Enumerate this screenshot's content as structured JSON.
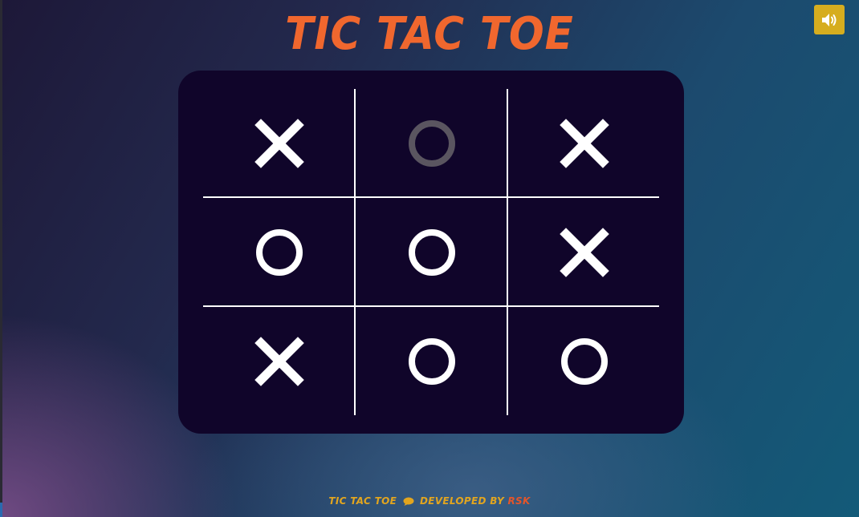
{
  "header": {
    "title": "Tic Tac Toe",
    "sound_icon": "speaker-volume-icon",
    "accent_color": "#f0672e",
    "button_color": "#d6ad1f"
  },
  "board": {
    "background": "#10052a",
    "cells": [
      {
        "mark": "X",
        "faded": false
      },
      {
        "mark": "O",
        "faded": true
      },
      {
        "mark": "X",
        "faded": false
      },
      {
        "mark": "O",
        "faded": false
      },
      {
        "mark": "O",
        "faded": false
      },
      {
        "mark": "X",
        "faded": false
      },
      {
        "mark": "X",
        "faded": false
      },
      {
        "mark": "O",
        "faded": false
      },
      {
        "mark": "O",
        "faded": false
      }
    ]
  },
  "footer": {
    "prefix": "Tic Tac Toe",
    "icon": "chat-bubble-icon",
    "middle": "Developed by",
    "author": "RSK"
  }
}
